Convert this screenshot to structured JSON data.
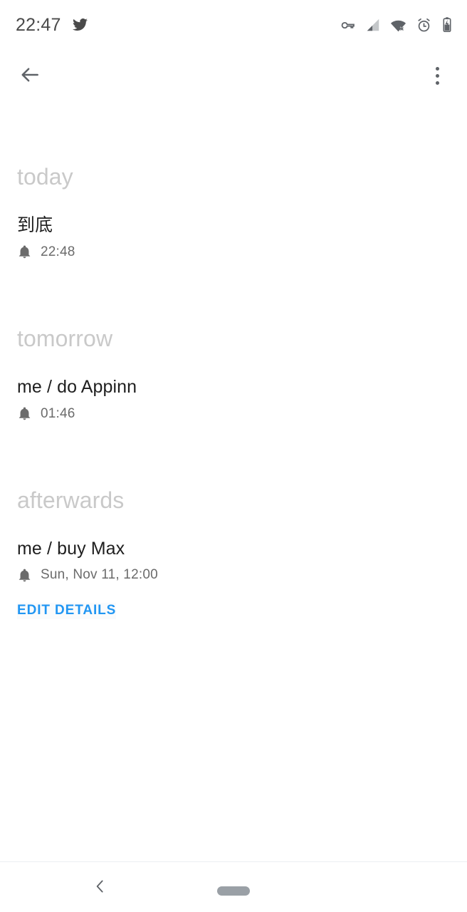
{
  "status_bar": {
    "clock": "22:47",
    "left_icons": [
      {
        "name": "twitter-notification-icon",
        "glyph": "twitter"
      }
    ],
    "right_icons": [
      {
        "name": "vpn-key-icon",
        "glyph": "key"
      },
      {
        "name": "cellular-signal-icon",
        "glyph": "signal-weak"
      },
      {
        "name": "wifi-off-icon",
        "glyph": "wifi-x"
      },
      {
        "name": "alarm-clock-icon",
        "glyph": "alarm"
      },
      {
        "name": "battery-charging-icon",
        "glyph": "battery-charging"
      }
    ]
  },
  "app_bar": {
    "back_label": "Back",
    "overflow_label": "More options"
  },
  "sections": [
    {
      "header": "today",
      "tasks": [
        {
          "title": "到底",
          "reminder": "22:48",
          "reminder_icon": "bell-icon"
        }
      ]
    },
    {
      "header": "tomorrow",
      "tasks": [
        {
          "title": "me / do Appinn",
          "reminder": "01:46",
          "reminder_icon": "bell-icon"
        }
      ]
    },
    {
      "header": "afterwards",
      "tasks": [
        {
          "title": "me / buy Max",
          "reminder": "Sun, Nov 11, 12:00",
          "reminder_icon": "bell-icon"
        }
      ]
    }
  ],
  "edit_details": {
    "label": "EDIT DETAILS",
    "color": "#2196f3"
  },
  "nav_bar": {
    "back_label": "Back",
    "home_label": "Home"
  },
  "colors": {
    "background": "#ffffff",
    "section_header": "#c9c9c9",
    "task_title": "#1f1f1f",
    "task_meta": "#6b6b6b",
    "accent": "#2196f3",
    "status_icon": "#5f6368"
  }
}
